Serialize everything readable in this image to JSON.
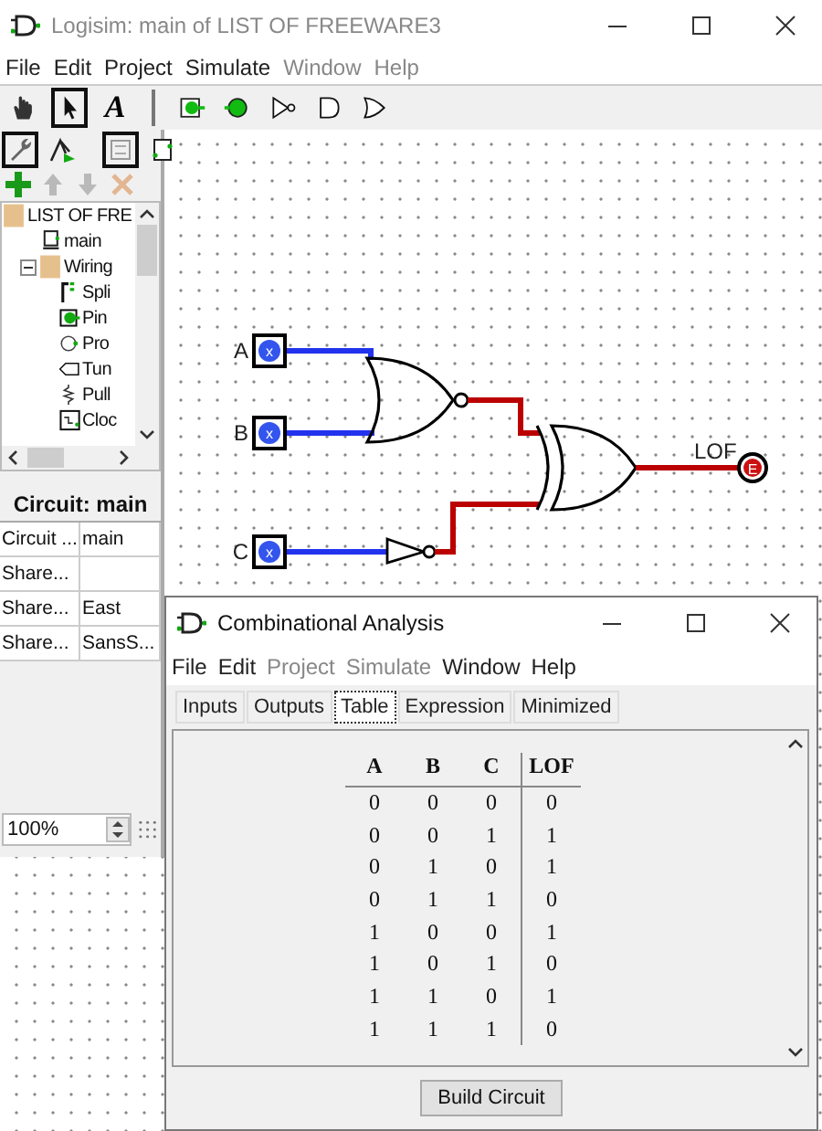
{
  "window": {
    "title": "Logisim: main of LIST OF FREEWARE3"
  },
  "menu": [
    {
      "label": "File",
      "disabled": false
    },
    {
      "label": "Edit",
      "disabled": false
    },
    {
      "label": "Project",
      "disabled": false
    },
    {
      "label": "Simulate",
      "disabled": false
    },
    {
      "label": "Window",
      "disabled": true
    },
    {
      "label": "Help",
      "disabled": true
    }
  ],
  "toolbar": [
    {
      "kind": "hand",
      "selected": false
    },
    {
      "kind": "arrow",
      "selected": true
    },
    {
      "kind": "text",
      "label": "A",
      "selected": false
    },
    {
      "kind": "separator"
    },
    {
      "kind": "input-pin"
    },
    {
      "kind": "output-pin"
    },
    {
      "kind": "not-gate"
    },
    {
      "kind": "and-gate"
    },
    {
      "kind": "or-gate"
    }
  ],
  "project_toolbar": [
    {
      "kind": "wrench",
      "selected": true
    },
    {
      "kind": "tree",
      "selected": false
    },
    {
      "kind": "layout",
      "selected": true
    },
    {
      "kind": "appearance",
      "selected": false
    }
  ],
  "project_actions": [
    {
      "kind": "add",
      "disabled": false
    },
    {
      "kind": "up",
      "disabled": true
    },
    {
      "kind": "down",
      "disabled": true
    },
    {
      "kind": "delete",
      "disabled": true
    }
  ],
  "tree": [
    {
      "label": "LIST OF FRE",
      "kind": "folder",
      "children": [
        {
          "label": "main",
          "kind": "circuit"
        },
        {
          "label": "Wiring",
          "kind": "folder",
          "expanded": true,
          "children": [
            {
              "label": "Spli",
              "kind": "splitter"
            },
            {
              "label": "Pin",
              "kind": "pin"
            },
            {
              "label": "Pro",
              "kind": "probe"
            },
            {
              "label": "Tun",
              "kind": "tunnel"
            },
            {
              "label": "Pull",
              "kind": "pull"
            },
            {
              "label": "Cloc",
              "kind": "clock"
            }
          ]
        }
      ]
    }
  ],
  "attributes": {
    "title": "Circuit: main",
    "rows": [
      {
        "name": "Circuit ...",
        "value": "main"
      },
      {
        "name": "Share..."
      },
      {
        "name": "Share...",
        "value": "East"
      },
      {
        "name": "Share...",
        "value": "SansS..."
      }
    ]
  },
  "zoom": "100%",
  "circuit": {
    "inputs": [
      {
        "label": "A",
        "value": "x"
      },
      {
        "label": "B",
        "value": "x"
      },
      {
        "label": "C",
        "value": "x"
      }
    ],
    "output": {
      "label": "LOF",
      "value": "E"
    }
  },
  "dialog": {
    "title": "Combinational Analysis",
    "menu": [
      {
        "label": "File",
        "disabled": false
      },
      {
        "label": "Edit",
        "disabled": false
      },
      {
        "label": "Project",
        "disabled": true
      },
      {
        "label": "Simulate",
        "disabled": true
      },
      {
        "label": "Window",
        "disabled": false
      },
      {
        "label": "Help",
        "disabled": false
      }
    ],
    "tabs": [
      {
        "label": "Inputs",
        "selected": false
      },
      {
        "label": "Outputs",
        "selected": false
      },
      {
        "label": "Table",
        "selected": true
      },
      {
        "label": "Expression",
        "selected": false
      },
      {
        "label": "Minimized",
        "selected": false
      }
    ],
    "table": {
      "columns": [
        "A",
        "B",
        "C",
        "LOF"
      ],
      "rows": [
        [
          "0",
          "0",
          "0",
          "0"
        ],
        [
          "0",
          "0",
          "1",
          "1"
        ],
        [
          "0",
          "1",
          "0",
          "1"
        ],
        [
          "0",
          "1",
          "1",
          "0"
        ],
        [
          "1",
          "0",
          "0",
          "1"
        ],
        [
          "1",
          "0",
          "1",
          "0"
        ],
        [
          "1",
          "1",
          "0",
          "1"
        ],
        [
          "1",
          "1",
          "1",
          "0"
        ]
      ]
    },
    "button": "Build Circuit"
  }
}
